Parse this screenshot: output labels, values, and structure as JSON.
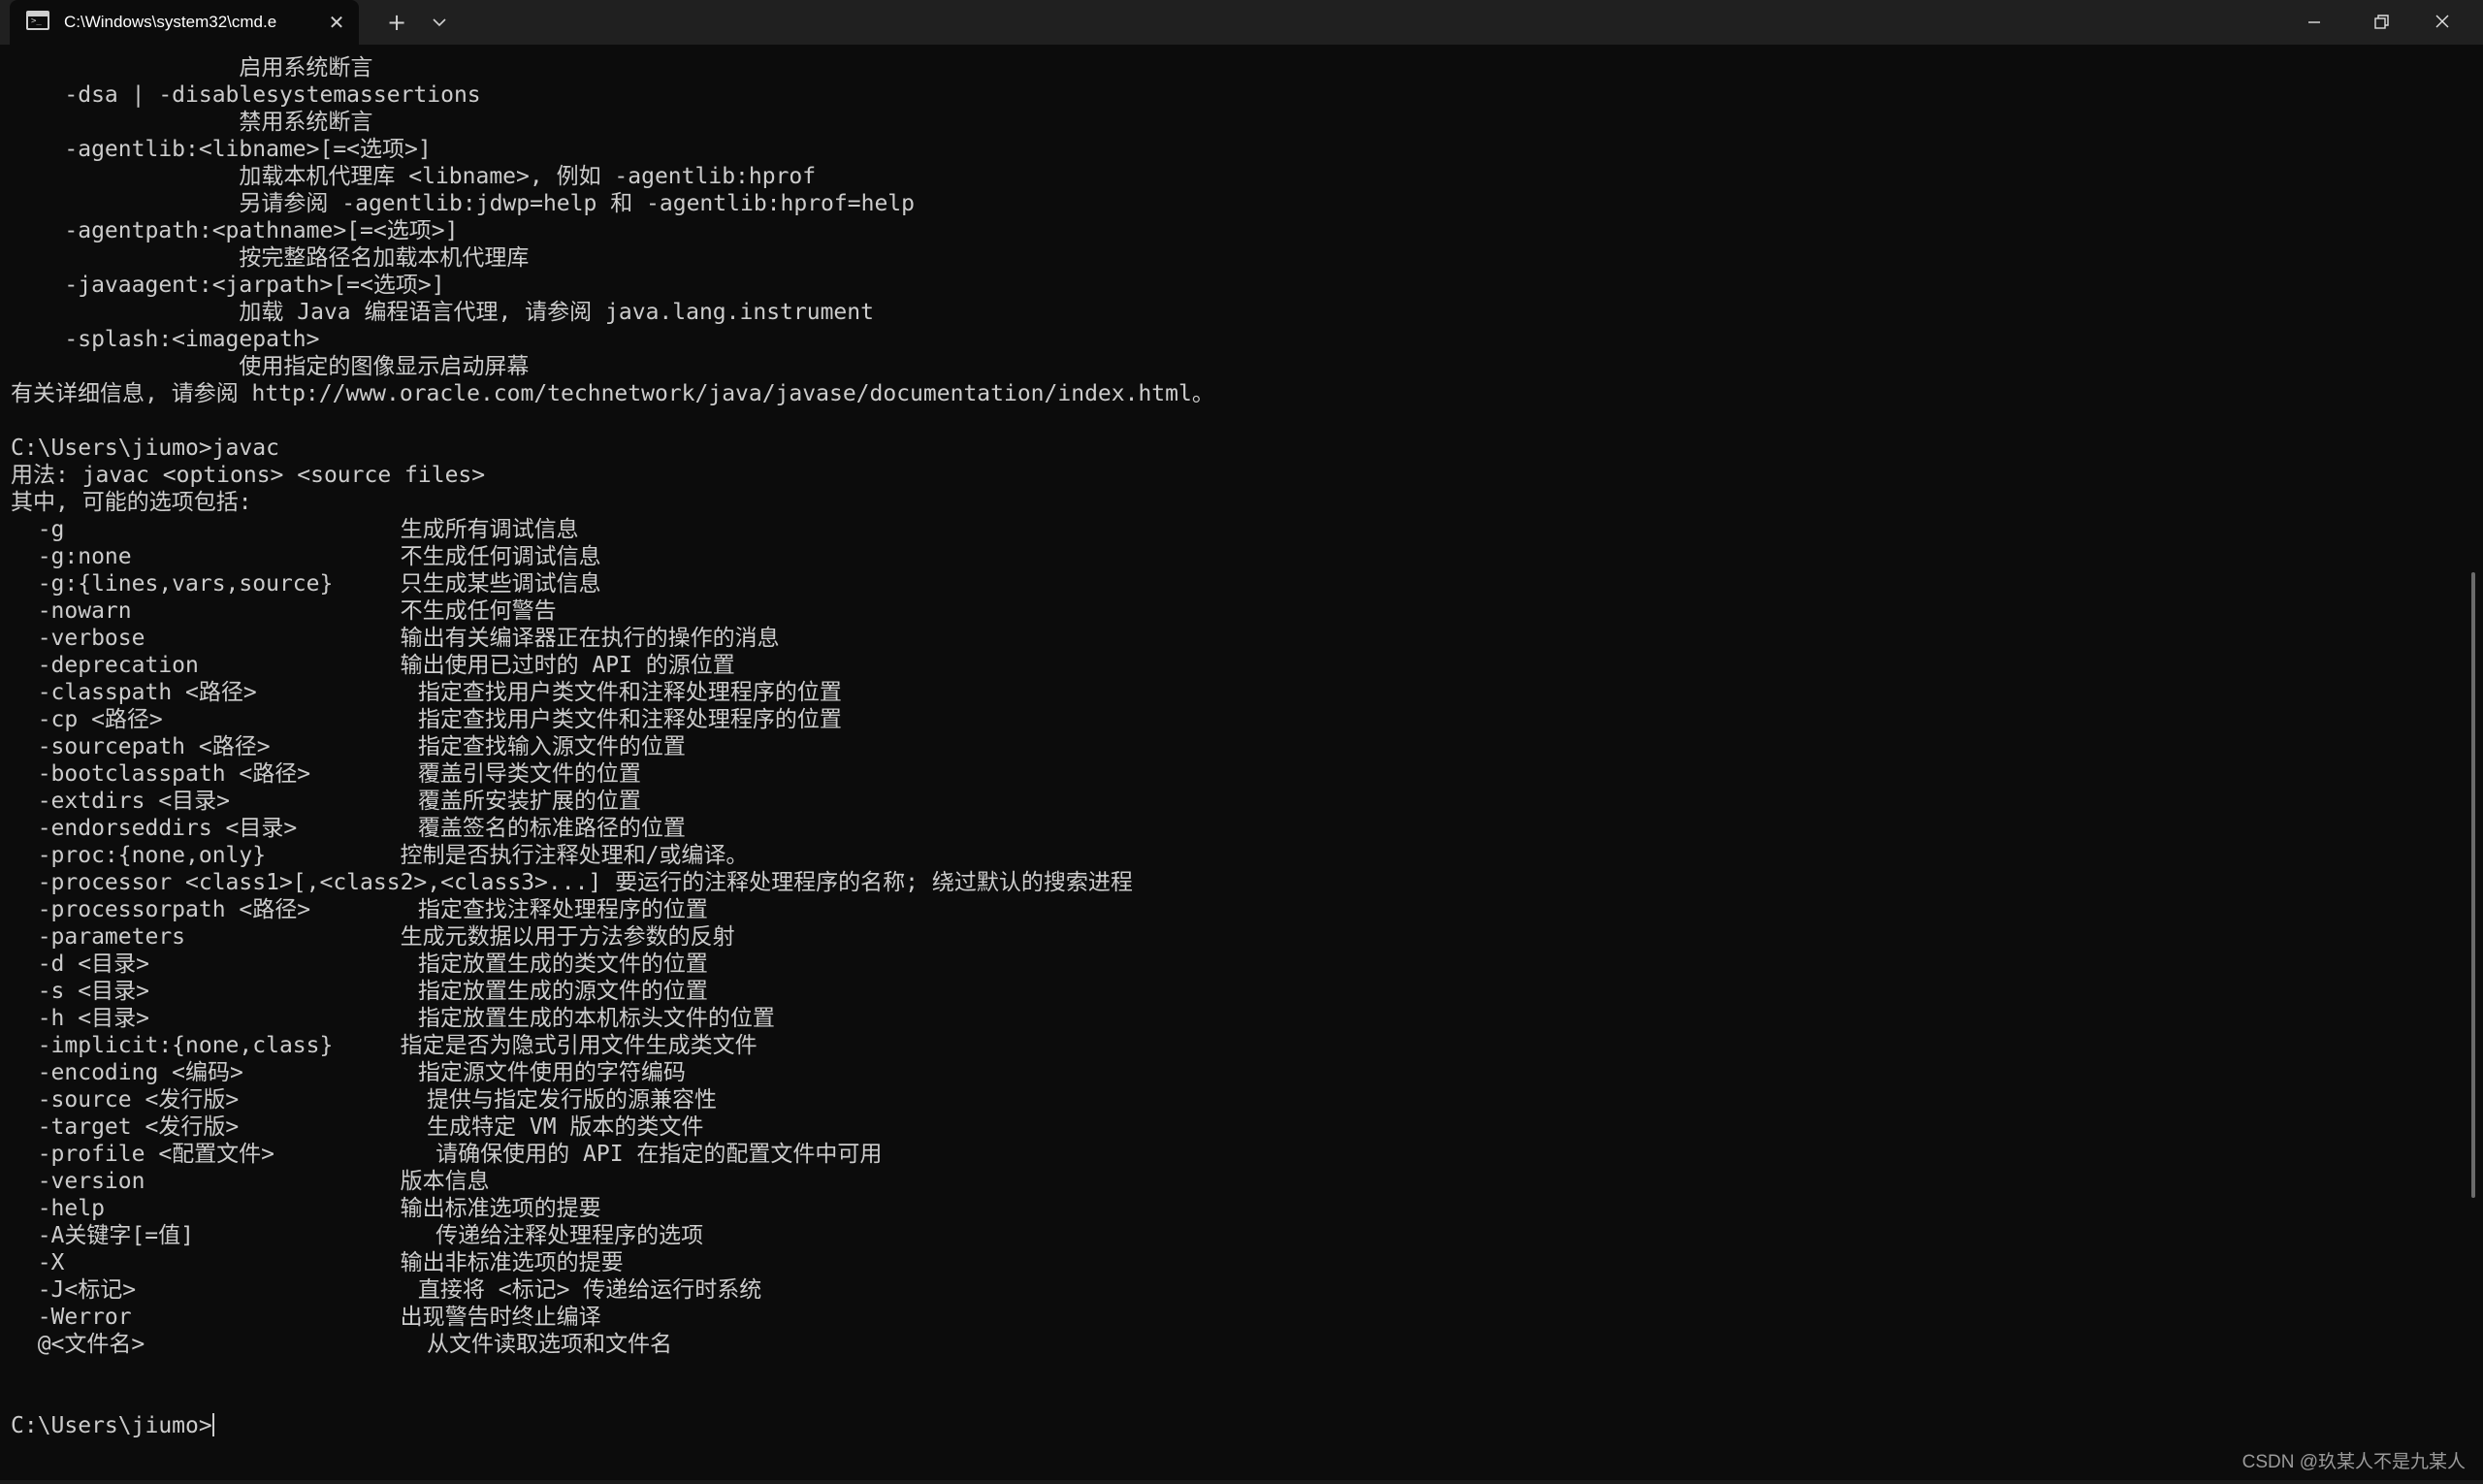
{
  "window": {
    "tab_title": "C:\\Windows\\system32\\cmd.e",
    "tab_icon": "terminal-icon",
    "tab_icon_prompt": ">_",
    "close_tab_glyph": "✕",
    "new_tab_glyph": "+",
    "dropdown_icon": "chevron-down-icon",
    "minimize_icon": "minimize-icon",
    "maximize_icon": "restore-icon",
    "close_icon": "close-icon"
  },
  "colors": {
    "background": "#0c0c0c",
    "titlebar": "#202020",
    "text": "#cccccc"
  },
  "terminal": {
    "lines": [
      "                 启用系统断言",
      "    -dsa | -disablesystemassertions",
      "                 禁用系统断言",
      "    -agentlib:<libname>[=<选项>]",
      "                 加载本机代理库 <libname>, 例如 -agentlib:hprof",
      "                 另请参阅 -agentlib:jdwp=help 和 -agentlib:hprof=help",
      "    -agentpath:<pathname>[=<选项>]",
      "                 按完整路径名加载本机代理库",
      "    -javaagent:<jarpath>[=<选项>]",
      "                 加载 Java 编程语言代理, 请参阅 java.lang.instrument",
      "    -splash:<imagepath>",
      "                 使用指定的图像显示启动屏幕",
      "有关详细信息, 请参阅 http://www.oracle.com/technetwork/java/javase/documentation/index.html。",
      "",
      "C:\\Users\\jiumo>javac",
      "用法: javac <options> <source files>",
      "其中, 可能的选项包括:",
      "  -g                         生成所有调试信息",
      "  -g:none                    不生成任何调试信息",
      "  -g:{lines,vars,source}     只生成某些调试信息",
      "  -nowarn                    不生成任何警告",
      "  -verbose                   输出有关编译器正在执行的操作的消息",
      "  -deprecation               输出使用已过时的 API 的源位置",
      "  -classpath <路径>            指定查找用户类文件和注释处理程序的位置",
      "  -cp <路径>                   指定查找用户类文件和注释处理程序的位置",
      "  -sourcepath <路径>           指定查找输入源文件的位置",
      "  -bootclasspath <路径>        覆盖引导类文件的位置",
      "  -extdirs <目录>              覆盖所安装扩展的位置",
      "  -endorseddirs <目录>         覆盖签名的标准路径的位置",
      "  -proc:{none,only}          控制是否执行注释处理和/或编译。",
      "  -processor <class1>[,<class2>,<class3>...] 要运行的注释处理程序的名称; 绕过默认的搜索进程",
      "  -processorpath <路径>        指定查找注释处理程序的位置",
      "  -parameters                生成元数据以用于方法参数的反射",
      "  -d <目录>                    指定放置生成的类文件的位置",
      "  -s <目录>                    指定放置生成的源文件的位置",
      "  -h <目录>                    指定放置生成的本机标头文件的位置",
      "  -implicit:{none,class}     指定是否为隐式引用文件生成类文件",
      "  -encoding <编码>             指定源文件使用的字符编码",
      "  -source <发行版>              提供与指定发行版的源兼容性",
      "  -target <发行版>              生成特定 VM 版本的类文件",
      "  -profile <配置文件>            请确保使用的 API 在指定的配置文件中可用",
      "  -version                   版本信息",
      "  -help                      输出标准选项的提要",
      "  -A关键字[=值]                  传递给注释处理程序的选项",
      "  -X                         输出非标准选项的提要",
      "  -J<标记>                     直接将 <标记> 传递给运行时系统",
      "  -Werror                    出现警告时终止编译",
      "  @<文件名>                     从文件读取选项和文件名",
      "",
      ""
    ],
    "prompt": "C:\\Users\\jiumo>"
  },
  "watermark": "CSDN @玖某人不是九某人"
}
